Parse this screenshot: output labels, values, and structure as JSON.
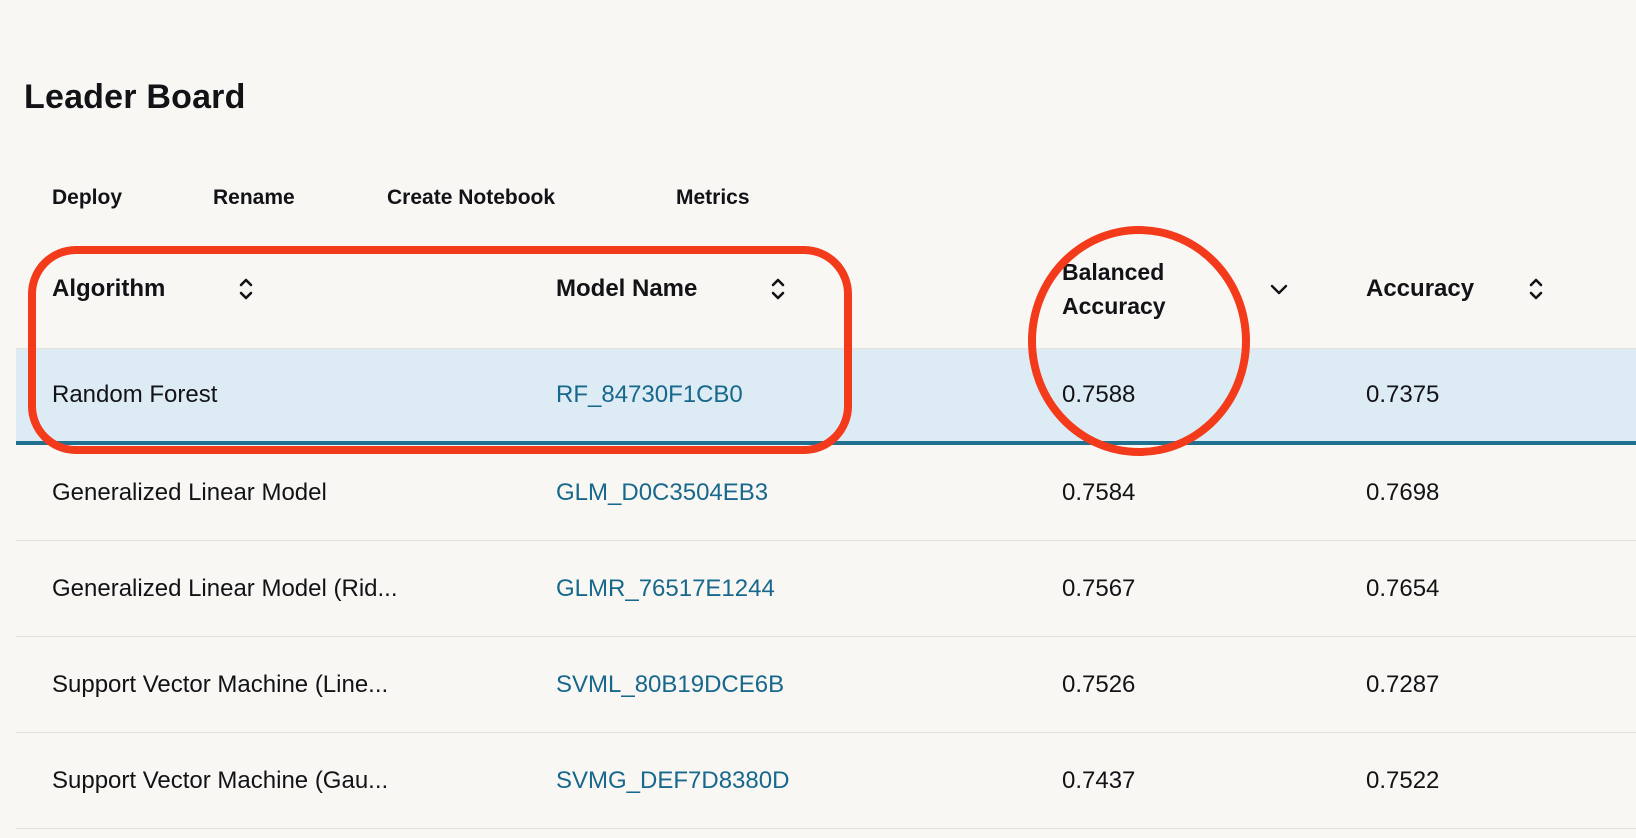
{
  "page": {
    "title": "Leader Board"
  },
  "toolbar": {
    "deploy_label": "Deploy",
    "rename_label": "Rename",
    "create_notebook_label": "Create Notebook",
    "metrics_label": "Metrics"
  },
  "table": {
    "columns": [
      {
        "key": "algorithm",
        "label": "Algorithm",
        "sort_icon": "sort-up-down-icon"
      },
      {
        "key": "model_name",
        "label": "Model Name",
        "sort_icon": "sort-up-down-icon"
      },
      {
        "key": "balanced_accuracy",
        "label": "Balanced Accuracy",
        "label_line1": "Balanced",
        "label_line2": "Accuracy",
        "sort_icon": "chevron-down-icon"
      },
      {
        "key": "accuracy",
        "label": "Accuracy",
        "sort_icon": "sort-up-down-icon"
      }
    ],
    "rows": [
      {
        "algorithm": "Random Forest",
        "model_name": "RF_84730F1CB0",
        "balanced_accuracy": "0.7588",
        "accuracy": "0.7375",
        "selected": true
      },
      {
        "algorithm": "Generalized Linear Model",
        "model_name": "GLM_D0C3504EB3",
        "balanced_accuracy": "0.7584",
        "accuracy": "0.7698",
        "selected": false
      },
      {
        "algorithm": "Generalized Linear Model (Rid...",
        "model_name": "GLMR_76517E1244",
        "balanced_accuracy": "0.7567",
        "accuracy": "0.7654",
        "selected": false
      },
      {
        "algorithm": "Support Vector Machine (Line...",
        "model_name": "SVML_80B19DCE6B",
        "balanced_accuracy": "0.7526",
        "accuracy": "0.7287",
        "selected": false
      },
      {
        "algorithm": "Support Vector Machine (Gau...",
        "model_name": "SVMG_DEF7D8380D",
        "balanced_accuracy": "0.7437",
        "accuracy": "0.7522",
        "selected": false
      }
    ]
  },
  "annotations": {
    "rect_target": "Algorithm and Model Name columns with selected row",
    "ellipse_target": "Balanced Accuracy header and top value 0.7588"
  },
  "colors": {
    "bg": "#f8f7f4",
    "text": "#131317",
    "row_highlight": "#ddebf5",
    "selected_border": "#20718f",
    "link": "#17688c",
    "divider": "#e3e1de",
    "annotation_red": "#f33a1a"
  }
}
